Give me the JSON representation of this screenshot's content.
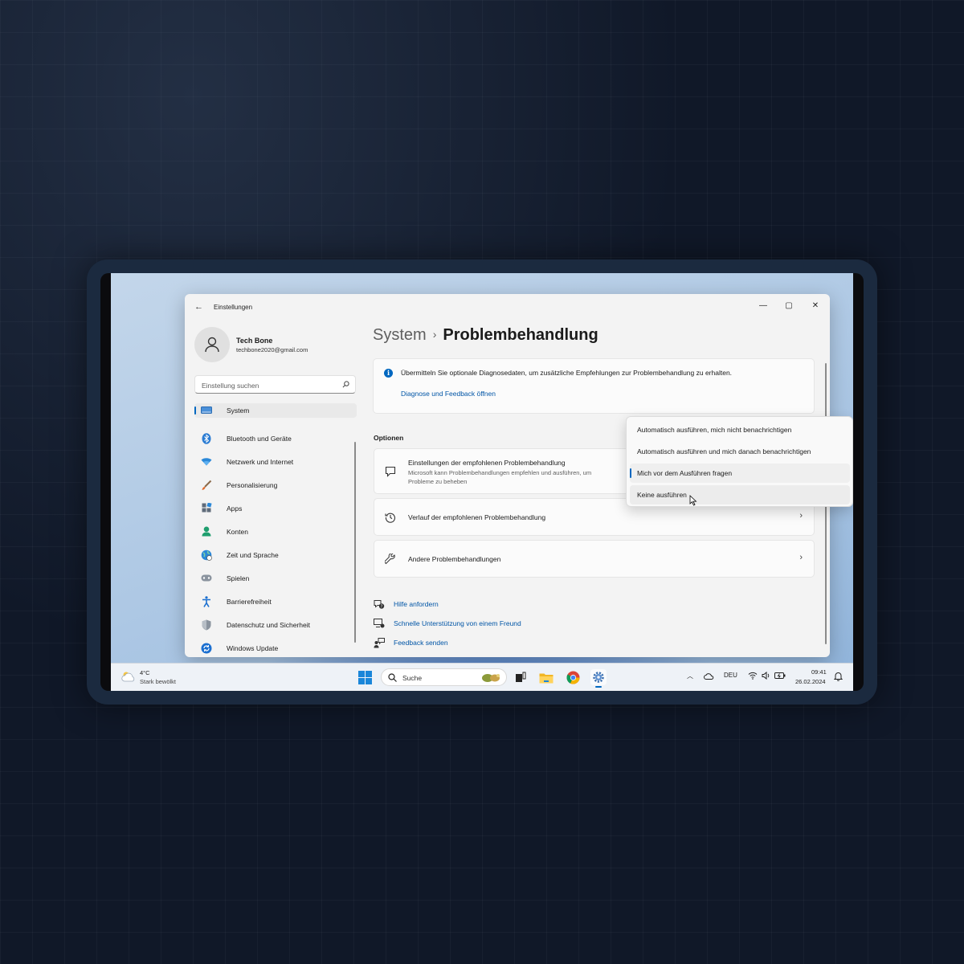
{
  "window": {
    "title": "Einstellungen",
    "controls": {
      "minimize": "—",
      "maximize": "▢",
      "close": "✕"
    }
  },
  "profile": {
    "name": "Tech Bone",
    "email": "techbone2020@gmail.com"
  },
  "search": {
    "placeholder": "Einstellung suchen"
  },
  "sidebar": {
    "items": [
      {
        "label": "System",
        "icon": "monitor-icon",
        "active": true
      },
      {
        "label": "Bluetooth und Geräte",
        "icon": "bluetooth-icon"
      },
      {
        "label": "Netzwerk und Internet",
        "icon": "wifi-icon"
      },
      {
        "label": "Personalisierung",
        "icon": "brush-icon"
      },
      {
        "label": "Apps",
        "icon": "apps-icon"
      },
      {
        "label": "Konten",
        "icon": "person-icon"
      },
      {
        "label": "Zeit und Sprache",
        "icon": "globe-clock-icon"
      },
      {
        "label": "Spielen",
        "icon": "gamepad-icon"
      },
      {
        "label": "Barrierefreiheit",
        "icon": "accessibility-icon"
      },
      {
        "label": "Datenschutz und Sicherheit",
        "icon": "shield-icon"
      },
      {
        "label": "Windows Update",
        "icon": "update-icon"
      }
    ]
  },
  "breadcrumb": {
    "parent": "System",
    "separator": "›",
    "current": "Problembehandlung"
  },
  "info": {
    "text": "Übermitteln Sie optionale Diagnosedaten, um zusätzliche Empfehlungen zur Problembehandlung zu erhalten.",
    "link": "Diagnose und Feedback öffnen"
  },
  "options": {
    "section_label": "Optionen",
    "recommended": {
      "title": "Einstellungen der empfohlenen Problembehandlung",
      "desc_line1": "Microsoft kann Problembehandlungen empfehlen und ausführen, um",
      "desc_line2": "Probleme zu beheben"
    },
    "history": {
      "title": "Verlauf der empfohlenen Problembehandlung",
      "chevron": "›"
    },
    "other": {
      "title": "Andere Problembehandlungen",
      "chevron": "›"
    }
  },
  "dropdown": {
    "items": [
      "Automatisch ausführen, mich nicht benachrichtigen",
      "Automatisch ausführen und mich danach benachrichtigen",
      "Mich vor dem Ausführen fragen",
      "Keine ausführen"
    ],
    "selected_index": 2,
    "hover_index": 3
  },
  "links": {
    "help": "Hilfe anfordern",
    "support": "Schnelle Unterstützung von einem Freund",
    "feedback": "Feedback senden"
  },
  "taskbar": {
    "weather": {
      "temp": "4°C",
      "desc": "Stark bewölkt"
    },
    "search": "Suche",
    "language": "DEU",
    "time": "09:41",
    "date": "26.02.2024"
  },
  "colors": {
    "accent": "#0067c0",
    "link": "#0055a6"
  }
}
